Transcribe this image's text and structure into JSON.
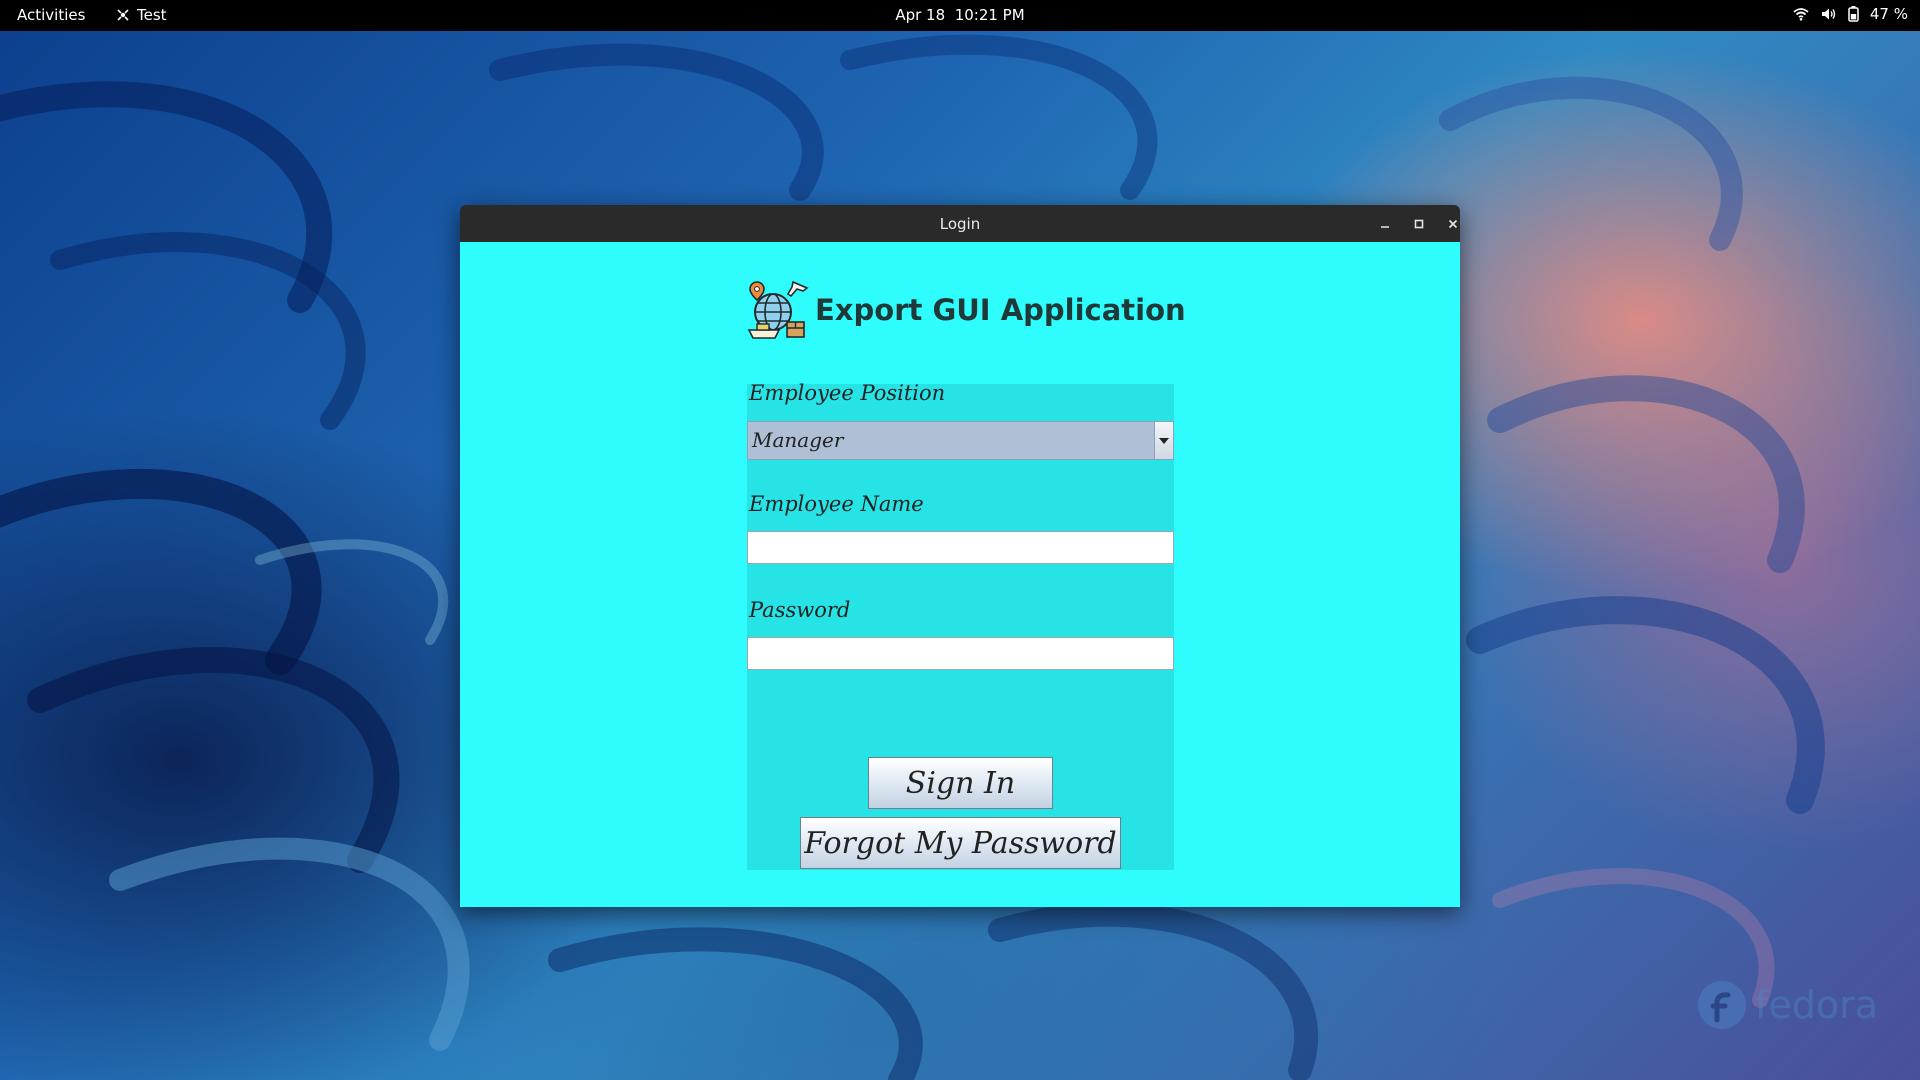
{
  "topbar": {
    "activities": "Activities",
    "app_name": "Test",
    "date": "Apr 18",
    "time": "10:21 PM",
    "battery": "47 %"
  },
  "desktop": {
    "watermark": "fedora"
  },
  "window": {
    "title": "Login",
    "controls": {
      "minimize": "–",
      "maximize": "□",
      "close": "✕"
    }
  },
  "app": {
    "title": "Export GUI Application",
    "position_label": "Employee Position",
    "position_value": "Manager",
    "name_label": "Employee Name",
    "name_value": "",
    "password_label": "Password",
    "password_value": "",
    "sign_in": "Sign In",
    "forgot": "Forgot My Password"
  },
  "colors": {
    "content_bg": "#2ffdfd",
    "panel_bg": "#26e3e6",
    "combo_bg": "#aebfd6",
    "titlebar_bg": "#2a2a2a"
  },
  "icons": [
    "wifi-icon",
    "volume-icon",
    "battery-icon",
    "app-logo-icon",
    "chevron-down-icon"
  ]
}
